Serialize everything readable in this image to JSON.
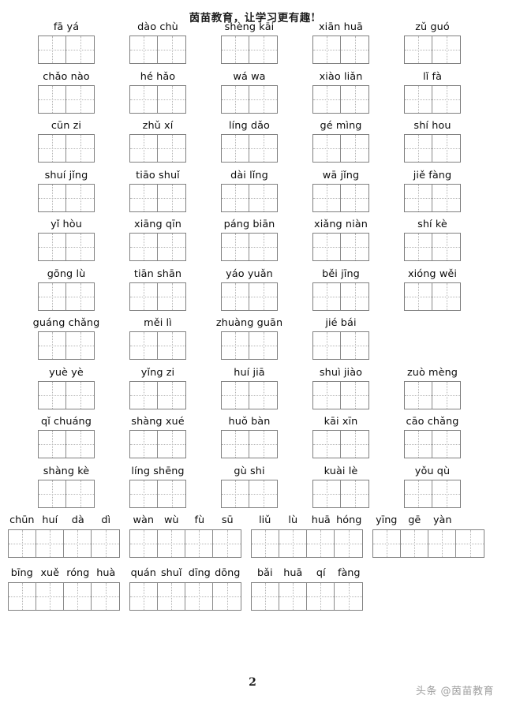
{
  "header": {
    "title": "茵苗教育，让学习更有趣!"
  },
  "footer": {
    "page_number": "2",
    "watermark": "头条 @茵苗教育"
  },
  "worksheet": {
    "cells_per_word_box": 2,
    "cells_per_idiom_box": 4,
    "rows": [
      {
        "words": [
          {
            "pinyin": "fā yá"
          },
          {
            "pinyin": "dào chù"
          },
          {
            "pinyin": "shèng kāi"
          },
          {
            "pinyin": "xiān huā"
          },
          {
            "pinyin": "zǔ guó"
          }
        ]
      },
      {
        "words": [
          {
            "pinyin": "chǎo nào"
          },
          {
            "pinyin": "hé hǎo"
          },
          {
            "pinyin": "wá wa"
          },
          {
            "pinyin": "xiào liǎn"
          },
          {
            "pinyin": "lǐ fà"
          }
        ]
      },
      {
        "words": [
          {
            "pinyin": "cūn zi"
          },
          {
            "pinyin": "zhǔ xí"
          },
          {
            "pinyin": "líng dǎo"
          },
          {
            "pinyin": "gé mìng"
          },
          {
            "pinyin": "shí hou"
          }
        ]
      },
      {
        "words": [
          {
            "pinyin": "shuí jǐng"
          },
          {
            "pinyin": "tiāo shuǐ"
          },
          {
            "pinyin": "dài lǐng"
          },
          {
            "pinyin": "wā jǐng"
          },
          {
            "pinyin": "jiě fàng"
          }
        ]
      },
      {
        "words": [
          {
            "pinyin": "yǐ hòu"
          },
          {
            "pinyin": "xiāng qīn"
          },
          {
            "pinyin": "páng biān"
          },
          {
            "pinyin": "xiǎng niàn"
          },
          {
            "pinyin": "shí kè"
          }
        ]
      },
      {
        "words": [
          {
            "pinyin": "gōng lù"
          },
          {
            "pinyin": "tiān shān"
          },
          {
            "pinyin": "yáo yuǎn"
          },
          {
            "pinyin": "běi jīng"
          },
          {
            "pinyin": "xióng wěi"
          }
        ]
      },
      {
        "words": [
          {
            "pinyin": "guáng chǎng"
          },
          {
            "pinyin": "měi lì"
          },
          {
            "pinyin": "zhuàng guān"
          },
          {
            "pinyin": "jié bái"
          },
          {
            "pinyin": ""
          }
        ]
      },
      {
        "words": [
          {
            "pinyin": "yuè yè"
          },
          {
            "pinyin": "yǐng zi"
          },
          {
            "pinyin": "huí jiā"
          },
          {
            "pinyin": "shuì jiào"
          },
          {
            "pinyin": "zuò mèng"
          }
        ]
      },
      {
        "words": [
          {
            "pinyin": "qǐ chuáng"
          },
          {
            "pinyin": "shàng xué"
          },
          {
            "pinyin": "huǒ bàn"
          },
          {
            "pinyin": "kāi xīn"
          },
          {
            "pinyin": "cāo chǎng"
          }
        ]
      },
      {
        "words": [
          {
            "pinyin": "shàng kè"
          },
          {
            "pinyin": "líng shēng"
          },
          {
            "pinyin": "gù shi"
          },
          {
            "pinyin": "kuài lè"
          },
          {
            "pinyin": "yǒu qù"
          }
        ]
      }
    ],
    "idiom_rows": [
      {
        "idioms": [
          {
            "syllables": [
              "chūn",
              "huí",
              "dà",
              "dì"
            ]
          },
          {
            "syllables": [
              "wàn",
              "wù",
              "fù",
              "sū"
            ]
          },
          {
            "syllables": [
              "liǔ",
              "lù",
              "huā",
              "hóng"
            ]
          },
          {
            "syllables": [
              "yīng",
              "gē",
              "yàn",
              ""
            ]
          }
        ]
      },
      {
        "idioms": [
          {
            "syllables": [
              "bīng",
              "xuě",
              "róng",
              "huà"
            ]
          },
          {
            "syllables": [
              "quán",
              "shuǐ",
              "dīng",
              "dōng"
            ]
          },
          {
            "syllables": [
              "bǎi",
              "huā",
              "qí",
              "fàng"
            ]
          },
          {
            "syllables": [
              "",
              "",
              "",
              ""
            ]
          }
        ]
      }
    ]
  }
}
